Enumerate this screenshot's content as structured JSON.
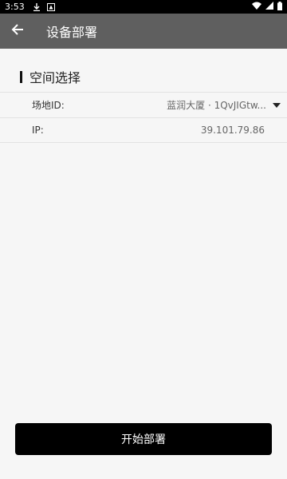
{
  "status_bar": {
    "time": "3:53",
    "icons": [
      "download-icon",
      "notification-icon"
    ],
    "right_icons": [
      "wifi-icon",
      "signal-icon",
      "battery-icon"
    ]
  },
  "app_bar": {
    "title": "设备部署",
    "back_icon": "back-arrow-icon"
  },
  "section": {
    "title": "空间选择"
  },
  "fields": {
    "site_label": "场地ID:",
    "site_value": "蓝润大厦 · 1QvJIGtw...",
    "ip_label": "IP:",
    "ip_value": "39.101.79.86"
  },
  "actions": {
    "deploy_label": "开始部署"
  },
  "colors": {
    "app_bar_bg": "#5f5f5f",
    "button_bg": "#000000",
    "page_bg": "#f6f6f6"
  }
}
